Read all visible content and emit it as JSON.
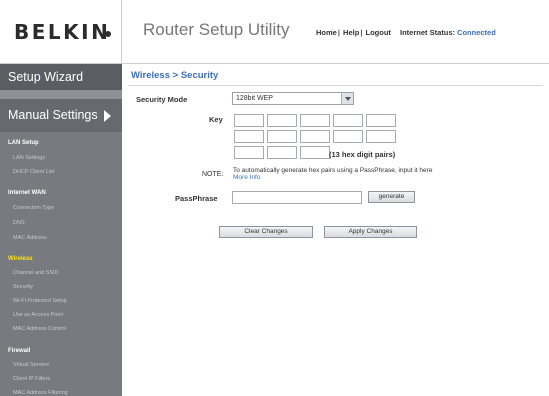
{
  "header": {
    "logo": "BELKIN",
    "app_title": "Router Setup Utility",
    "links": [
      "Home",
      "Help",
      "Logout"
    ],
    "link_separator": "|",
    "internet_status_label": "Internet Status:",
    "internet_status_value": "Connected",
    "status_color": "#3d6fb6"
  },
  "sidebar": {
    "wizard": "Setup Wizard",
    "manual": "Manual Settings",
    "sections": [
      {
        "title": "LAN Setup",
        "items": [
          "LAN Settings",
          "DHCP Client List"
        ]
      },
      {
        "title": "Internet WAN",
        "items": [
          "Connection Type",
          "DNS",
          "MAC Address"
        ]
      },
      {
        "title": "Wireless",
        "items": [
          "Channel and SSID",
          "Security",
          "Wi-Fi Protected Setup",
          "Use as Access Point",
          "MAC Address Control"
        ],
        "active": true
      },
      {
        "title": "Firewall",
        "items": [
          "Virtual Servers",
          "Client IP Filters",
          "MAC Address Filtering"
        ]
      }
    ],
    "active_color": "#ffe21a"
  },
  "main": {
    "breadcrumb": "Wireless > Security",
    "security_mode_label": "Security Mode",
    "security_mode_value": "128bit WEP",
    "key_label": "Key",
    "key_values": [
      "",
      "",
      "",
      "",
      "",
      "",
      "",
      "",
      "",
      "",
      "",
      "",
      ""
    ],
    "hex_hint": "(13 hex digit pairs)",
    "note_label": "NOTE:",
    "note_text": "To automatically generate hex pairs using a PassPhrase, input it here",
    "more_info": "More Info",
    "passphrase_label": "PassPhrase",
    "passphrase_value": "",
    "generate_button": "generate",
    "clear_button": "Clear Changes",
    "apply_button": "Apply Changes",
    "accent_color": "#3d6fb6"
  }
}
